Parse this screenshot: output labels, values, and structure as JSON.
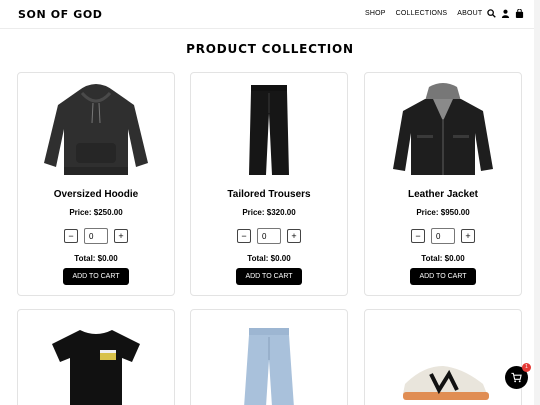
{
  "header": {
    "brand": "SON OF GOD",
    "nav": [
      "SHOP",
      "COLLECTIONS",
      "ABOUT"
    ],
    "icons": [
      "search-icon",
      "user-icon",
      "bag-icon"
    ]
  },
  "page_title": "PRODUCT COLLECTION",
  "products": [
    {
      "name": "Oversized Hoodie",
      "price": "Price: $250.00",
      "qty": "0",
      "total": "Total: $0.00",
      "button": "ADD TO CART"
    },
    {
      "name": "Tailored Trousers",
      "price": "Price: $320.00",
      "qty": "0",
      "total": "Total: $0.00",
      "button": "ADD TO CART"
    },
    {
      "name": "Leather Jacket",
      "price": "Price: $950.00",
      "qty": "0",
      "total": "Total: $0.00",
      "button": "ADD TO CART"
    },
    {
      "name": "",
      "image": "t-shirt"
    },
    {
      "name": "",
      "image": "jeans"
    },
    {
      "name": "",
      "image": "sneaker"
    }
  ],
  "controls": {
    "minus": "−",
    "plus": "+"
  },
  "cart_fab": {
    "icon": "cart-icon",
    "badge": "1"
  },
  "colors": {
    "button_bg": "#000000",
    "badge": "#e53935"
  }
}
